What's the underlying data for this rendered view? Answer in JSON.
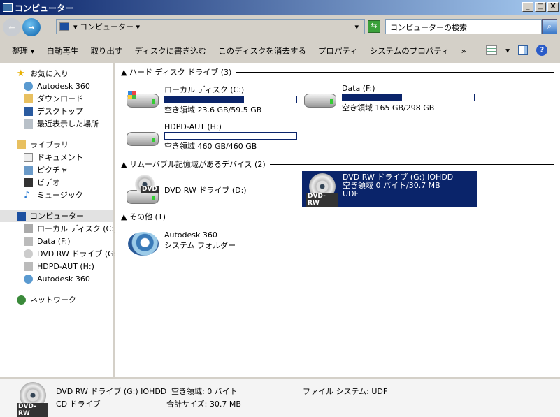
{
  "window": {
    "title": "コンピューター",
    "min": "_",
    "max": "□",
    "close": "X"
  },
  "address": {
    "path": "▾ コンピューター ▾",
    "dropdown": "▾",
    "search_placeholder": "コンピューターの検索"
  },
  "toolbar": {
    "items": [
      "整理 ▾",
      "自動再生",
      "取り出す",
      "ディスクに書き込む",
      "このディスクを消去する",
      "プロパティ",
      "システムのプロパティ",
      "»"
    ],
    "view_dropdown": "▾",
    "help": "?"
  },
  "sidebar": {
    "favorites": {
      "label": "お気に入り",
      "items": [
        "Autodesk 360",
        "ダウンロード",
        "デスクトップ",
        "最近表示した場所"
      ]
    },
    "libraries": {
      "label": "ライブラリ",
      "items": [
        "ドキュメント",
        "ピクチャ",
        "ビデオ",
        "ミュージック"
      ]
    },
    "computer": {
      "label": "コンピューター",
      "items": [
        "ローカル ディスク (C:)",
        "Data (F:)",
        "DVD RW ドライブ (G:)",
        "HDPD-AUT (H:)",
        "Autodesk 360"
      ]
    },
    "network": {
      "label": "ネットワーク"
    }
  },
  "groups": {
    "hdd": {
      "label": "ハード ディスク ドライブ (3)",
      "drives": [
        {
          "name": "ローカル ディスク (C:)",
          "space": "空き領域 23.6 GB/59.5 GB",
          "used_fraction": 0.6
        },
        {
          "name": "Data (F:)",
          "space": "空き領域 165 GB/298 GB",
          "used_fraction": 0.45
        },
        {
          "name": "HDPD-AUT (H:)",
          "space": "空き領域 460 GB/460 GB",
          "used_fraction": 0.0
        }
      ]
    },
    "removable": {
      "label": "リムーバブル記憶域があるデバイス (2)",
      "drives": [
        {
          "name": "DVD RW ドライブ (D:)",
          "badge": "DVD"
        },
        {
          "name": "DVD RW ドライブ (G:) IOHDD",
          "space": "空き領域 0 バイト/30.7 MB",
          "fs": "UDF",
          "badge": "DVD-RW"
        }
      ]
    },
    "other": {
      "label": "その他 (1)",
      "items": [
        {
          "name": "Autodesk 360",
          "type": "システム フォルダー"
        }
      ]
    }
  },
  "details": {
    "name": "DVD RW ドライブ (G:) IOHDD",
    "type": "CD ドライブ",
    "free": "空き領域: 0 バイト",
    "total": "合計サイズ: 30.7 MB",
    "fs": "ファイル システム: UDF",
    "badge": "DVD-RW"
  },
  "colors": {
    "selection": "#0a246a",
    "title_start": "#0a246a",
    "title_end": "#a6caf0"
  }
}
